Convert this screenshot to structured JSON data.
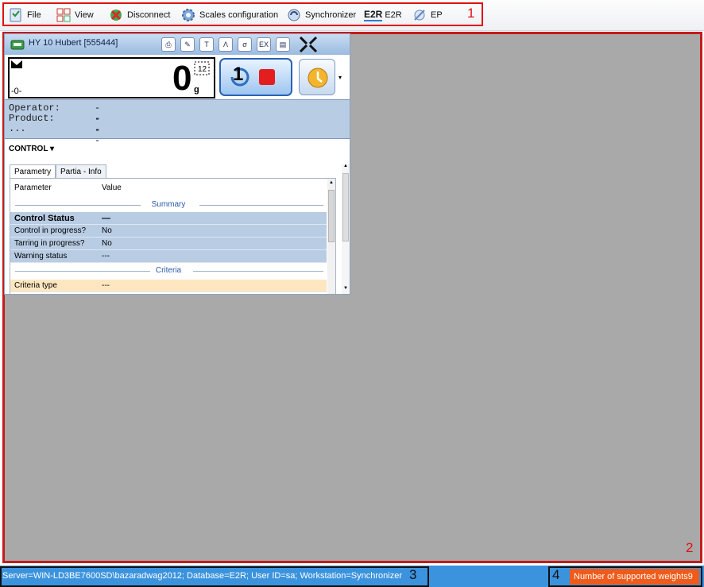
{
  "toolbar": {
    "items": [
      {
        "label": "File",
        "icon": "file-icon"
      },
      {
        "label": "View",
        "icon": "view-icon"
      },
      {
        "label": "Disconnect",
        "icon": "disconnect-icon"
      },
      {
        "label": "Scales configuration",
        "icon": "gear-icon"
      },
      {
        "label": "Synchronizer",
        "icon": "synchronizer-icon"
      },
      {
        "label": "E2R",
        "icon": "e2r-icon"
      },
      {
        "label": "EP",
        "icon": "ep-icon"
      }
    ],
    "e2r_logo_text": "E2R"
  },
  "markers": {
    "m1": "1",
    "m2": "2",
    "m3": "3",
    "m4": "4"
  },
  "scale": {
    "title": "HY 10 Hubert [555444]",
    "buttons": [
      "T",
      "Λ",
      "σ",
      "EX"
    ],
    "weight": "0",
    "unit": "g",
    "zero_indicator": "-0-",
    "tare_number": "1",
    "info": [
      {
        "label": "Operator:",
        "value": "---"
      },
      {
        "label": "Product:",
        "value": "---"
      },
      {
        "label": "...",
        "value": ""
      }
    ],
    "control_menu": "CONTROL ▾",
    "tabs": [
      "Parametry",
      "Partia - Info"
    ],
    "grid": {
      "headers": [
        "Parameter",
        "Value"
      ],
      "section_summary": "Summary",
      "rows_summary": [
        {
          "name": "Control Status",
          "value": "—"
        },
        {
          "name": "Control in progress?",
          "value": "No"
        },
        {
          "name": "Tarring in progress?",
          "value": "No"
        },
        {
          "name": "Warning status",
          "value": "---"
        }
      ],
      "section_criteria": "Criteria",
      "rows_criteria": [
        {
          "name": "Criteria type",
          "value": "---"
        }
      ]
    }
  },
  "statusbar": {
    "connection": "Server=WIN-LD3BE7600SD\\bazaradwag2012; Database=E2R; User ID=sa; Workstation=Synchronizer",
    "weights": "Number of supported weights9"
  },
  "colors": {
    "accent": "#3c93dd",
    "highlight": "#b8cce4",
    "badge": "#ef5b1a",
    "frame": "#d11111"
  }
}
